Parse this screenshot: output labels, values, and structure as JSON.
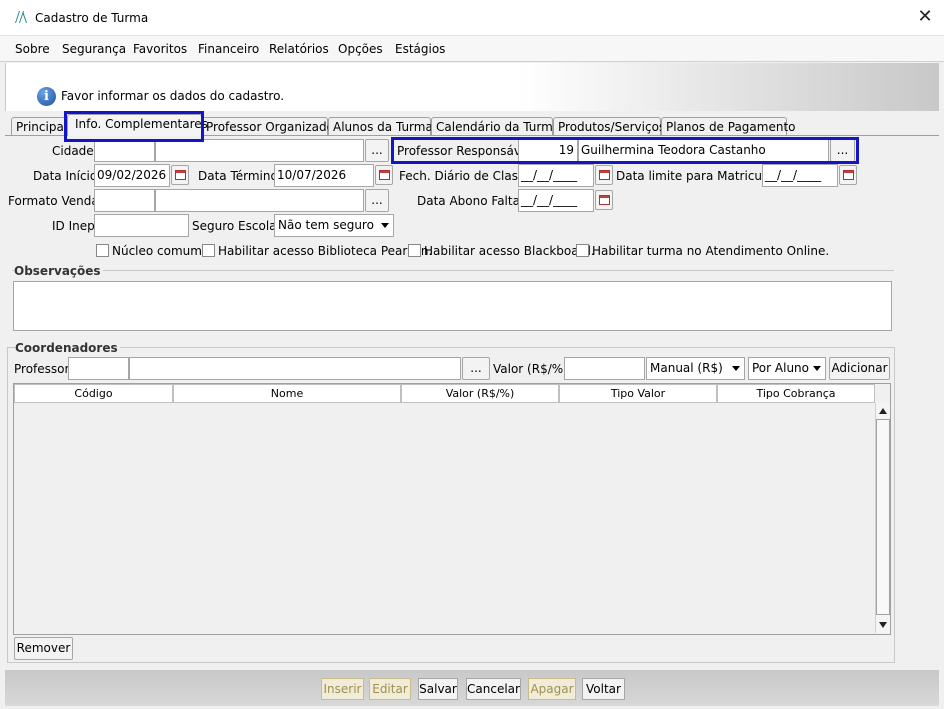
{
  "window": {
    "title": "Cadastro de Turma",
    "close_glyph": "✕"
  },
  "menu": [
    "Sobre",
    "Segurança",
    "Favoritos",
    "Financeiro",
    "Relatórios",
    "Opções",
    "Estágios"
  ],
  "info": {
    "message": "Favor informar os dados do cadastro.",
    "icon_glyph": "i"
  },
  "tabs": [
    "Principal",
    "Info. Complementares",
    "Professor Organizador",
    "Alunos da Turma",
    "Calendário da Turma",
    "Produtos/Serviços",
    "Planos de Pagamento"
  ],
  "form": {
    "cidade_label": "Cidade:",
    "ellipsis": "...",
    "professor_resp_label": "Professor Responsável:",
    "professor_resp_code": "19",
    "professor_resp_name": "Guilhermina Teodora Castanho",
    "data_inicio_label": "Data Início:",
    "data_inicio_value": "09/02/2026",
    "data_termino_label": "Data Término:",
    "data_termino_value": "10/07/2026",
    "fech_diario_label": "Fech. Diário de Classe:",
    "date_placeholder": "__/__/____",
    "data_limite_label": "Data limite para Matriculas:",
    "formato_venda_label": "Formato Venda:",
    "data_abono_label": "Data Abono Faltas:",
    "id_inep_label": "ID Inep:",
    "seguro_label": "Seguro Escolar:",
    "seguro_value": "Não tem seguro",
    "checkboxes": [
      "Núcleo comum.",
      "Habilitar acesso Biblioteca Pearson.",
      "Habilitar acesso Blackboard.",
      "Habilitar turma no Atendimento Online."
    ]
  },
  "observacoes": {
    "label": "Observações"
  },
  "coordenadores": {
    "label": "Coordenadores",
    "professor_label": "Professor:",
    "valor_label": "Valor (R$/%):",
    "tipo_select": "Manual (R$)",
    "cobranca_select": "Por Aluno",
    "adicionar": "Adicionar",
    "columns": [
      "Código",
      "Nome",
      "Valor (R$/%)",
      "Tipo Valor",
      "Tipo Cobrança"
    ],
    "remover": "Remover"
  },
  "footer": {
    "inserir": "Inserir",
    "editar": "Editar",
    "salvar": "Salvar",
    "cancelar": "Cancelar",
    "apagar": "Apagar",
    "voltar": "Voltar"
  }
}
